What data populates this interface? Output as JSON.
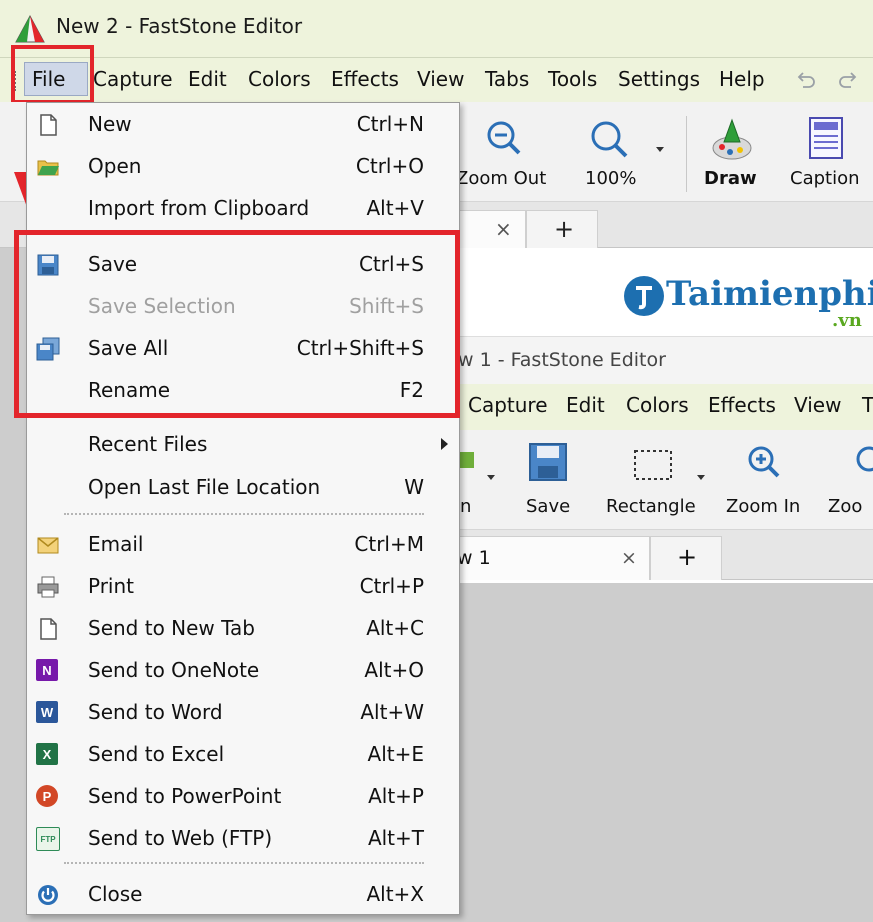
{
  "window": {
    "title": "New 2 - FastStone Editor"
  },
  "menubar": [
    "File",
    "Capture",
    "Edit",
    "Colors",
    "Effects",
    "View",
    "Tabs",
    "Tools",
    "Settings",
    "Help"
  ],
  "toolbar": {
    "zoom_out": "Zoom Out",
    "zoom_level": "100%",
    "draw": "Draw",
    "caption": "Caption"
  },
  "tabbar": {
    "close": "×",
    "add": "+"
  },
  "watermark": {
    "brand": "Taimienphi",
    "suffix": ".vn"
  },
  "inner_window": {
    "title": "w 1 - FastStone Editor",
    "menubar": [
      "Capture",
      "Edit",
      "Colors",
      "Effects",
      "View",
      "T"
    ],
    "toolbar": [
      "n",
      "Save",
      "Rectangle",
      "Zoom In",
      "Zoo"
    ],
    "tab": "w 1",
    "tab_close": "×",
    "tab_add": "+"
  },
  "file_menu": {
    "groups": [
      [
        {
          "label": "New",
          "shortcut": "Ctrl+N",
          "icon": "new-page-icon"
        },
        {
          "label": "Open",
          "shortcut": "Ctrl+O",
          "icon": "open-folder-icon"
        },
        {
          "label": "Import from Clipboard",
          "shortcut": "Alt+V",
          "icon": ""
        }
      ],
      [
        {
          "label": "Save",
          "shortcut": "Ctrl+S",
          "icon": "floppy-disk-icon"
        },
        {
          "label": "Save Selection",
          "shortcut": "Shift+S",
          "icon": "",
          "disabled": true
        },
        {
          "label": "Save All",
          "shortcut": "Ctrl+Shift+S",
          "icon": "floppy-disks-icon"
        },
        {
          "label": "Rename",
          "shortcut": "F2",
          "icon": ""
        }
      ],
      [
        {
          "label": "Recent Files",
          "shortcut": "",
          "icon": "",
          "submenu": true
        },
        {
          "label": "Open Last File Location",
          "shortcut": "W",
          "icon": ""
        }
      ],
      [
        {
          "label": "Email",
          "shortcut": "Ctrl+M",
          "icon": "envelope-icon"
        },
        {
          "label": "Print",
          "shortcut": "Ctrl+P",
          "icon": "printer-icon"
        },
        {
          "label": "Send to New Tab",
          "shortcut": "Alt+C",
          "icon": "new-page-icon"
        },
        {
          "label": "Send to OneNote",
          "shortcut": "Alt+O",
          "icon": "onenote-icon"
        },
        {
          "label": "Send to Word",
          "shortcut": "Alt+W",
          "icon": "word-icon"
        },
        {
          "label": "Send to Excel",
          "shortcut": "Alt+E",
          "icon": "excel-icon"
        },
        {
          "label": "Send to PowerPoint",
          "shortcut": "Alt+P",
          "icon": "powerpoint-icon"
        },
        {
          "label": "Send to Web (FTP)",
          "shortcut": "Alt+T",
          "icon": "ftp-icon"
        }
      ],
      [
        {
          "label": "Close",
          "shortcut": "Alt+X",
          "icon": "power-icon"
        }
      ]
    ]
  },
  "badge_letters": {
    "onenote": "N",
    "word": "W",
    "excel": "X",
    "powerpoint": "P",
    "ftp": "FTP"
  },
  "colors": {
    "highlight_red": "#e3252b",
    "menubar_bg": "#eef3dc",
    "word_blue": "#2b579a",
    "excel_green": "#217346",
    "powerpoint_orange": "#d24726",
    "onenote_purple": "#7719aa",
    "brand_blue": "#1d6fb0",
    "brand_green": "#5aa820"
  }
}
